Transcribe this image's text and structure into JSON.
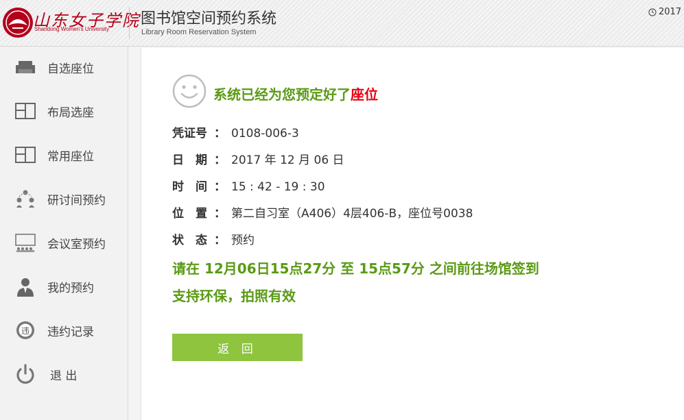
{
  "header": {
    "logo_script": "山东女子学院",
    "logo_en": "Shandong Women's University",
    "title": "图书馆空间预约系统",
    "subtitle": "Library Room Reservation System",
    "clock_text": "2017"
  },
  "sidebar": {
    "items": [
      {
        "label": "自选座位",
        "icon": "sofa-icon"
      },
      {
        "label": "布局选座",
        "icon": "layout-icon"
      },
      {
        "label": "常用座位",
        "icon": "layout-icon"
      },
      {
        "label": "研讨间预约",
        "icon": "group-icon"
      },
      {
        "label": "会议室预约",
        "icon": "meeting-room-icon"
      },
      {
        "label": "我的预约",
        "icon": "user-icon"
      },
      {
        "label": "违约记录",
        "icon": "violation-icon"
      },
      {
        "label": "退 出",
        "icon": "power-icon"
      }
    ]
  },
  "main": {
    "success_prefix": "系统已经为您预定好了",
    "success_highlight": "座位",
    "fields": {
      "voucher": {
        "label": "凭证号",
        "value": "0108-006-3"
      },
      "date": {
        "label": "日　期",
        "value": "2017 年 12 月 06 日"
      },
      "time": {
        "label": "时　间",
        "value": "15 : 42 - 19 : 30"
      },
      "location": {
        "label": "位　置",
        "value": "第二自习室（A406）4层406-B，座位号0038"
      },
      "status": {
        "label": "状　态",
        "value": "预约"
      }
    },
    "colon": "：",
    "notice_line1": "请在 12月06日15点27分 至 15点57分 之间前往场馆签到",
    "notice_line2": "支持环保，拍照有效",
    "back_button": "返 回"
  },
  "colors": {
    "accent_green": "#8ec43e",
    "text_green": "#5a9a14",
    "highlight_red": "#e60012",
    "brand_red": "#b3001b"
  }
}
